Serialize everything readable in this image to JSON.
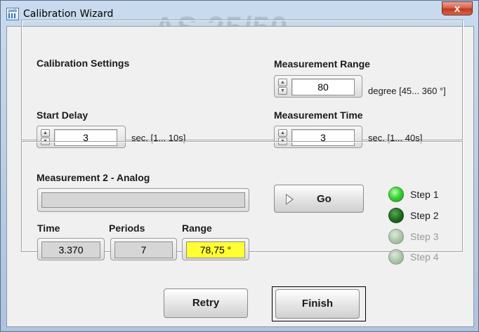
{
  "window": {
    "title": "Calibration Wizard",
    "watermark": "AS 25/50",
    "app_icon_text": "pwb",
    "close_glyph": "x"
  },
  "calibration": {
    "section_title": "Calibration Settings",
    "start_delay": {
      "label": "Start Delay",
      "value": "3",
      "unit": "sec. [1... 10s]"
    },
    "measurement_range": {
      "label": "Measurement Range",
      "value": "80",
      "unit": "degree [45... 360 °]"
    },
    "measurement_time": {
      "label": "Measurement Time",
      "value": "3",
      "unit": "sec. [1... 40s]"
    }
  },
  "measurement": {
    "title": "Measurement 2 - Analog",
    "progress": 0,
    "go_label": "Go",
    "time": {
      "label": "Time",
      "value": "3.370"
    },
    "periods": {
      "label": "Periods",
      "value": "7"
    },
    "range": {
      "label": "Range",
      "value": "78,75 °",
      "highlight_color": "#ffff33"
    },
    "steps": [
      {
        "label": "Step 1",
        "state": "active"
      },
      {
        "label": "Step 2",
        "state": "done"
      },
      {
        "label": "Step 3",
        "state": "inactive"
      },
      {
        "label": "Step 4",
        "state": "inactive"
      }
    ]
  },
  "buttons": {
    "retry_label": "Retry",
    "finish_label": "Finish"
  },
  "colors": {
    "led_on": "#3fd43a",
    "led_dark": "#1c6b1c",
    "led_off": "#9fbe9c",
    "close_red": "#c0391f"
  }
}
